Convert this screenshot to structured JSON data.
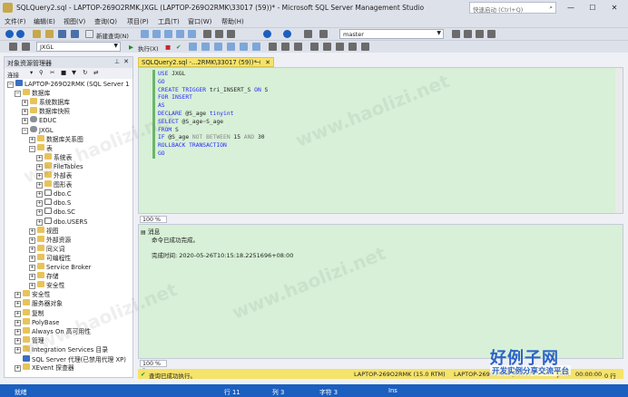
{
  "window": {
    "title": "SQLQuery2.sql - LAPTOP-269O2RMK.JXGL (LAPTOP-269O2RMK\\33017 (59))* - Microsoft SQL Server Management Studio",
    "quick_launch_placeholder": "快速启动 (Ctrl+Q)",
    "quick_launch_icon": "search-icon"
  },
  "menu": [
    "文件(F)",
    "编辑(E)",
    "视图(V)",
    "查询(Q)",
    "项目(P)",
    "工具(T)",
    "窗口(W)",
    "帮助(H)"
  ],
  "toolbar1": {
    "new_query": "新建查询(N)",
    "db_selector": "master"
  },
  "toolbar2": {
    "db_combo": "JXGL",
    "execute": "执行(X)"
  },
  "object_explorer": {
    "title": "对象资源管理器",
    "connect": "连接",
    "tree": [
      {
        "label": "LAPTOP-269O2RMK (SQL Server 1",
        "icon": "server-icon",
        "exp": "−"
      },
      {
        "label": "数据库",
        "icon": "folder-icon",
        "exp": "−"
      },
      {
        "label": "系统数据库",
        "icon": "folder-icon",
        "exp": "+"
      },
      {
        "label": "数据库快照",
        "icon": "folder-icon",
        "exp": "+"
      },
      {
        "label": "EDUC",
        "icon": "database-icon",
        "exp": "+"
      },
      {
        "label": "JXGL",
        "icon": "database-icon",
        "exp": "−"
      },
      {
        "label": "数据库关系图",
        "icon": "folder-icon",
        "exp": "+"
      },
      {
        "label": "表",
        "icon": "folder-icon",
        "exp": "−"
      },
      {
        "label": "系统表",
        "icon": "folder-icon",
        "exp": "+"
      },
      {
        "label": "FileTables",
        "icon": "folder-icon",
        "exp": "+"
      },
      {
        "label": "外部表",
        "icon": "folder-icon",
        "exp": "+"
      },
      {
        "label": "图形表",
        "icon": "folder-icon",
        "exp": "+"
      },
      {
        "label": "dbo.C",
        "icon": "table-icon",
        "exp": "+"
      },
      {
        "label": "dbo.S",
        "icon": "table-icon",
        "exp": "+"
      },
      {
        "label": "dbo.SC",
        "icon": "table-icon",
        "exp": "+"
      },
      {
        "label": "dbo.USERS",
        "icon": "table-icon",
        "exp": "+"
      },
      {
        "label": "视图",
        "icon": "folder-icon",
        "exp": "+"
      },
      {
        "label": "外部资源",
        "icon": "folder-icon",
        "exp": "+"
      },
      {
        "label": "同义词",
        "icon": "folder-icon",
        "exp": "+"
      },
      {
        "label": "可编程性",
        "icon": "folder-icon",
        "exp": "+"
      },
      {
        "label": "Service Broker",
        "icon": "folder-icon",
        "exp": "+"
      },
      {
        "label": "存储",
        "icon": "folder-icon",
        "exp": "+"
      },
      {
        "label": "安全性",
        "icon": "folder-icon",
        "exp": "+"
      },
      {
        "label": "安全性",
        "icon": "folder-icon",
        "exp": "+"
      },
      {
        "label": "服务器对象",
        "icon": "folder-icon",
        "exp": "+"
      },
      {
        "label": "复制",
        "icon": "folder-icon",
        "exp": "+"
      },
      {
        "label": "PolyBase",
        "icon": "folder-icon",
        "exp": "+"
      },
      {
        "label": "Always On 高可用性",
        "icon": "folder-icon",
        "exp": "+"
      },
      {
        "label": "管理",
        "icon": "folder-icon",
        "exp": "+"
      },
      {
        "label": "Integration Services 目录",
        "icon": "folder-icon",
        "exp": "+"
      },
      {
        "label": "SQL Server 代理(已禁用代理 XP)",
        "icon": "agent-icon",
        "exp": ""
      },
      {
        "label": "XEvent 探查器",
        "icon": "folder-icon",
        "exp": "+"
      }
    ]
  },
  "editor": {
    "tab_label": "SQLQuery2.sql -...2RMK\\33017 (59))*",
    "code": [
      [
        {
          "t": "USE ",
          "c": "kw"
        },
        {
          "t": "JXGL",
          "c": ""
        }
      ],
      [
        {
          "t": "GO",
          "c": "kw"
        }
      ],
      [
        {
          "t": "CREATE TRIGGER ",
          "c": "kw"
        },
        {
          "t": "tri_INSERT_S ",
          "c": ""
        },
        {
          "t": "ON ",
          "c": "kw"
        },
        {
          "t": "S",
          "c": ""
        }
      ],
      [
        {
          "t": "FOR INSERT",
          "c": "kw"
        }
      ],
      [
        {
          "t": "AS",
          "c": "kw"
        }
      ],
      [
        {
          "t": "DECLARE ",
          "c": "kw"
        },
        {
          "t": "@S_age ",
          "c": ""
        },
        {
          "t": "tinyint",
          "c": "kw"
        }
      ],
      [
        {
          "t": "SELECT ",
          "c": "kw"
        },
        {
          "t": "@S_age",
          "c": ""
        },
        {
          "t": "=",
          "c": "gr"
        },
        {
          "t": "S_age",
          "c": ""
        }
      ],
      [
        {
          "t": "FROM ",
          "c": "kw"
        },
        {
          "t": "S",
          "c": ""
        }
      ],
      [
        {
          "t": "IF ",
          "c": "kw"
        },
        {
          "t": "@S_age ",
          "c": ""
        },
        {
          "t": "NOT BETWEEN ",
          "c": "gr"
        },
        {
          "t": "15 ",
          "c": ""
        },
        {
          "t": "AND ",
          "c": "gr"
        },
        {
          "t": "30",
          "c": ""
        }
      ],
      [
        {
          "t": "ROLLBACK TRANSACTION",
          "c": "kw"
        }
      ],
      [
        {
          "t": "GO",
          "c": "kw"
        }
      ]
    ]
  },
  "zoom": "100 %",
  "messages": {
    "tab": "消息",
    "line1": "命令已成功完成。",
    "line2": "完成时间: 2020-05-26T10:15:18.2251696+08:00"
  },
  "query_status": {
    "text": "查询已成功执行。",
    "server": "LAPTOP-269O2RMK (15.0 RTM)",
    "user": "LAPTOP-269O2RMK\\33017 ...",
    "db": "JXGL",
    "time": "00:00:00",
    "rows": "0 行"
  },
  "statusbar": {
    "ready": "就绪",
    "row": "行 11",
    "col": "列 3",
    "char": "字符 3",
    "ins": "Ins"
  },
  "watermark_text": "www.haolizi.net",
  "brand": {
    "line1": "好例子网",
    "line2": "开发实例分享交流平台"
  }
}
